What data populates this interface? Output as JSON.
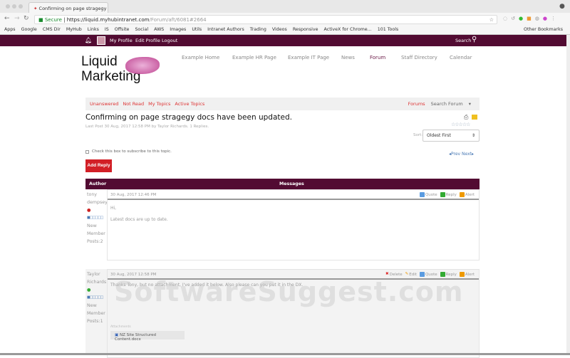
{
  "browser": {
    "tab_title": "Confirming on page stragegy",
    "secure_label": "Secure",
    "url_host": "https://liquid.myhubintranet.com",
    "url_path": "/Forum/aft/6081#2664",
    "bookmarks": [
      "Apps",
      "Google",
      "CMS Dir",
      "MyHub",
      "Links",
      "IS",
      "Offsite",
      "Social",
      "AWS",
      "Images",
      "Utils",
      "Intranet Authors",
      "Trading",
      "Videos",
      "Responsive",
      "ActiveX for Chrome...",
      "101 Tools"
    ],
    "other_bookmarks": "Other Bookmarks"
  },
  "topbar": {
    "my_profile": "My Profile",
    "edit_profile": "Edit Profile",
    "logout": "Logout",
    "search": "Search"
  },
  "logo": {
    "line1": "Liquid",
    "line2": "Marketing"
  },
  "nav": [
    "Example Home",
    "Example HR Page",
    "Example IT Page",
    "News",
    "Forum",
    "Staff Directory",
    "Calendar"
  ],
  "filters": [
    "Unanswered",
    "Not Read",
    "My Topics",
    "Active Topics"
  ],
  "forums_link": "Forums",
  "search_forum": "Search Forum",
  "topic": {
    "title": "Confirming on page stragegy docs have been updated.",
    "meta": "Last Post 30 Aug, 2017 12:58 PM by Taylor Richards. 1 Replies."
  },
  "sort": {
    "label": "Sort:",
    "value": "Oldest First"
  },
  "subscribe_label": "Check this box to subscribe to this topic.",
  "prev": "Prev",
  "next": "Next",
  "add_reply": "Add Reply",
  "table": {
    "author_header": "Author",
    "messages_header": "Messages"
  },
  "posts": [
    {
      "author1": "tony",
      "author2": "dempsey",
      "rank1": "New",
      "rank2": "Member",
      "posts": "Posts:2",
      "date": "30 Aug, 2017 12:46 PM",
      "actions": [
        "Quote",
        "Reply",
        "Alert"
      ],
      "lines": [
        "Hi,",
        "Latest docs are up to date."
      ]
    },
    {
      "author1": "Taylor",
      "author2": "Richards",
      "rank1": "New",
      "rank2": "Member",
      "posts": "Posts:1",
      "date": "30 Aug, 2017 12:58 PM",
      "actions": [
        "Delete",
        "Edit",
        "Quote",
        "Reply",
        "Alert"
      ],
      "lines": [
        "Thanks Tony, but no attachment, I've added it below. Also please can you put it in the DX."
      ],
      "attachments_label": "Attachments",
      "attachment": "NZ Site Structured Content.docx"
    }
  ],
  "watermark": "SoftwareSuggest.com"
}
